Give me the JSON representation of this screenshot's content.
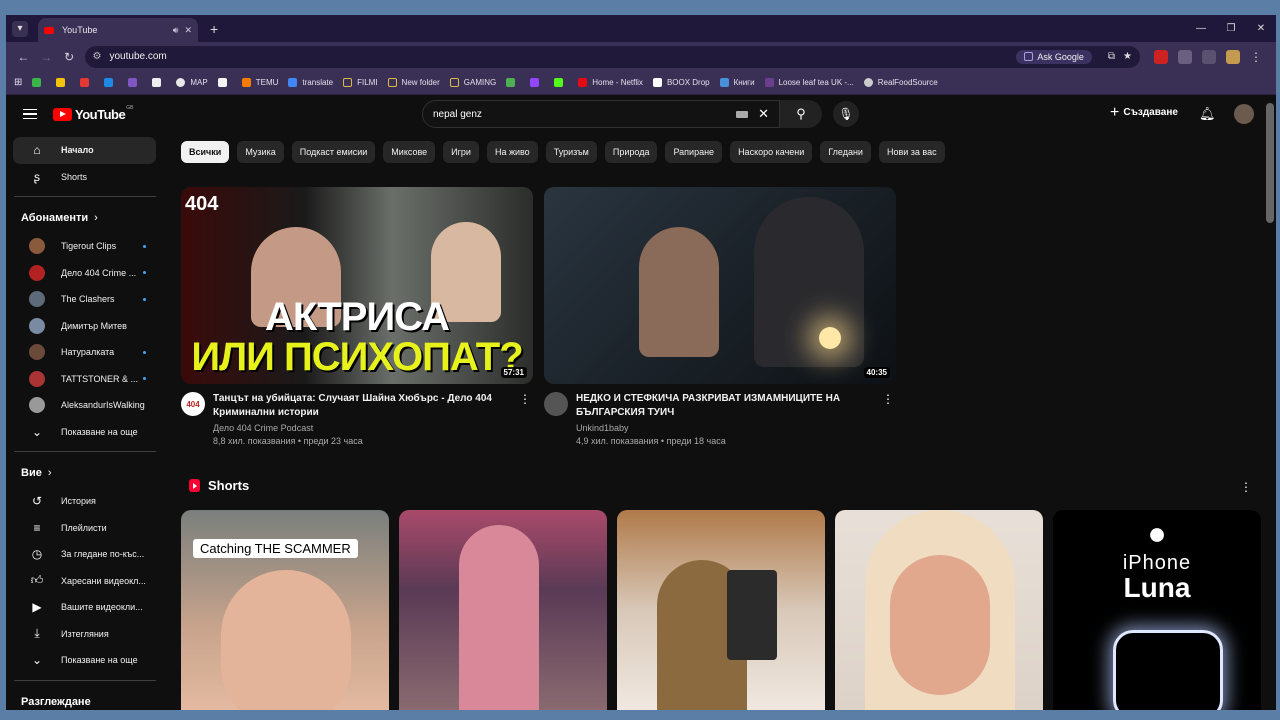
{
  "browser": {
    "tab_title": "YouTube",
    "url": "youtube.com",
    "ask_google": "Ask Google",
    "bookmarks": [
      {
        "label": "MAP",
        "color": "#e8e8e8"
      },
      {
        "label": "TEMU",
        "color": "#f57c00"
      },
      {
        "label": "translate",
        "color": "#4285f4"
      },
      {
        "label": "FILMI",
        "color": "#e0b84a"
      },
      {
        "label": "New folder",
        "color": "#e0b84a"
      },
      {
        "label": "GAMING",
        "color": "#e0b84a"
      },
      {
        "label": "Home - Netflix",
        "color": "#e50914"
      },
      {
        "label": "BOOX Drop",
        "color": "#ffffff"
      },
      {
        "label": "Книги",
        "color": "#4a8fd9"
      },
      {
        "label": "Loose leaf tea UK -...",
        "color": "#6b3e8e"
      },
      {
        "label": "RealFoodSource",
        "color": "#cccccc"
      }
    ]
  },
  "youtube": {
    "logo_text": "YouTube",
    "region": "GB",
    "search_query": "nepal genz",
    "create_label": "Създаване"
  },
  "sidebar": {
    "main": [
      {
        "label": "Начало",
        "icon": "home-icon",
        "active": true
      },
      {
        "label": "Shorts",
        "icon": "shorts-icon"
      }
    ],
    "subscriptions_title": "Абонаменти",
    "subscriptions": [
      {
        "label": "Tigerout Clips",
        "color": "#8a5a3c",
        "dot": true
      },
      {
        "label": "Дело 404 Crime ...",
        "color": "#b22222",
        "dot": true
      },
      {
        "label": "The Clashers",
        "color": "#5c6a7a",
        "dot": true
      },
      {
        "label": "Димитър Митев",
        "color": "#7a8aa0",
        "dot": false
      },
      {
        "label": "Натуралката",
        "color": "#6b4a3a",
        "dot": true
      },
      {
        "label": "TATTSTONER & ...",
        "color": "#a33",
        "dot": true
      },
      {
        "label": "AleksandurIsWalking",
        "color": "#999",
        "dot": false
      }
    ],
    "show_more": "Показване на още",
    "you_title": "Вие",
    "you_items": [
      {
        "label": "История",
        "icon": "history-icon"
      },
      {
        "label": "Плейлисти",
        "icon": "playlists-icon"
      },
      {
        "label": "За гледане по-къс...",
        "icon": "watch-later-icon"
      },
      {
        "label": "Харесани видеокл...",
        "icon": "liked-icon"
      },
      {
        "label": "Вашите видеокли...",
        "icon": "your-videos-icon"
      },
      {
        "label": "Изтегляния",
        "icon": "downloads-icon"
      },
      {
        "label": "Показване на още",
        "icon": "chevron-down-icon"
      }
    ],
    "explore_title": "Разглеждане"
  },
  "chips": [
    "Всички",
    "Музика",
    "Подкаст емисии",
    "Миксове",
    "Игри",
    "На живо",
    "Туризъм",
    "Природа",
    "Рапиране",
    "Наскоро качени",
    "Гледани",
    "Нови за вас"
  ],
  "videos": [
    {
      "title": "Танцът на убийцата: Случаят Шайна Хюбърс - Дело 404 Криминални истории",
      "channel": "Дело 404 Crime Podcast",
      "stats": "8,8 хил. показвания • преди 23 часа",
      "duration": "57:31",
      "thumb_line1": "АКТРИСА",
      "thumb_line2": "ИЛИ ПСИХОПАТ?",
      "badge": "404"
    },
    {
      "title": "НЕДКО И СТЕФКИЧА РАЗКРИВАТ ИЗМАМНИЦИТЕ НА БЪЛГАРСКИЯ ТУИЧ",
      "channel": "Unkind1baby",
      "stats": "4,9 хил. показвания • преди 18 часа",
      "duration": "40:35"
    }
  ],
  "shorts": {
    "title": "Shorts",
    "items": [
      {
        "caption": "Catching THE SCAMMER"
      },
      {
        "caption": ""
      },
      {
        "caption": ""
      },
      {
        "caption": ""
      },
      {
        "caption": "",
        "line1": "iPhone",
        "line2": "Luna"
      }
    ]
  }
}
